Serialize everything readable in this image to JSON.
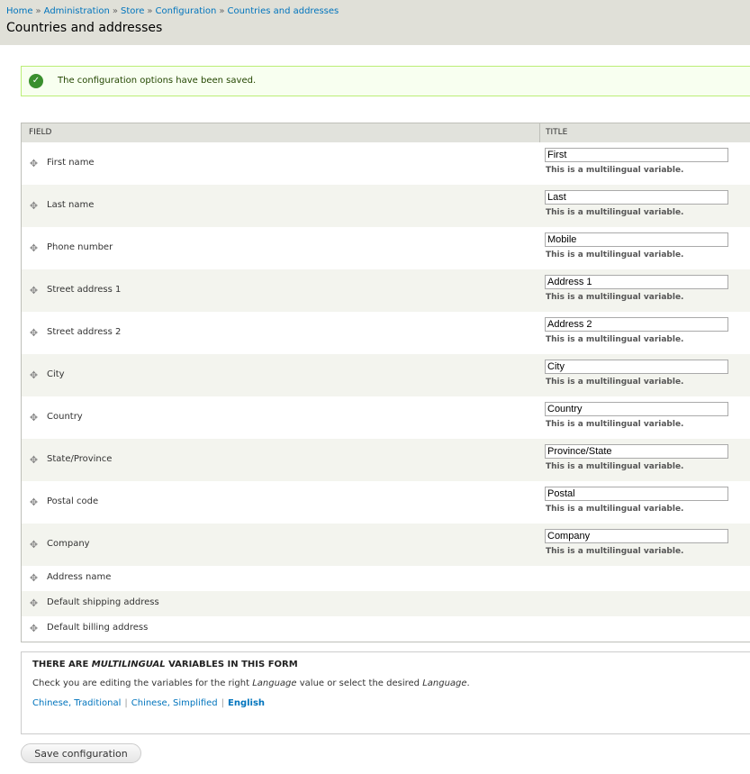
{
  "breadcrumb": [
    "Home",
    "Administration",
    "Store",
    "Configuration",
    "Countries and addresses"
  ],
  "breadcrumb_separator": "»",
  "page_title": "Countries and addresses",
  "status": {
    "icon": "check-circle-icon",
    "message": "The configuration options have been saved."
  },
  "table": {
    "headers": {
      "field": "FIELD",
      "title": "TITLE"
    },
    "description": "This is a multilingual variable.",
    "rows": [
      {
        "field": "First name",
        "title": "First"
      },
      {
        "field": "Last name",
        "title": "Last"
      },
      {
        "field": "Phone number",
        "title": "Mobile"
      },
      {
        "field": "Street address 1",
        "title": "Address 1"
      },
      {
        "field": "Street address 2",
        "title": "Address 2"
      },
      {
        "field": "City",
        "title": "City"
      },
      {
        "field": "Country",
        "title": "Country"
      },
      {
        "field": "State/Province",
        "title": "Province/State"
      },
      {
        "field": "Postal code",
        "title": "Postal"
      },
      {
        "field": "Company",
        "title": "Company"
      },
      {
        "field": "Address name"
      },
      {
        "field": "Default shipping address"
      },
      {
        "field": "Default billing address"
      }
    ]
  },
  "multilingual": {
    "title_prefix": "THERE ARE ",
    "title_em": "MULTILINGUAL",
    "title_suffix": " VARIABLES IN THIS FORM",
    "text_1": "Check you are editing the variables for the right ",
    "text_em_1": "Language",
    "text_2": " value or select the desired ",
    "text_em_2": "Language",
    "text_3": ".",
    "languages": [
      "Chinese, Traditional",
      "Chinese, Simplified",
      "English"
    ],
    "active_language": "English"
  },
  "save_button": "Save configuration",
  "colors": {
    "link": "#0074bd",
    "success_border": "#bbee77",
    "success_icon": "#3a8f2e"
  }
}
